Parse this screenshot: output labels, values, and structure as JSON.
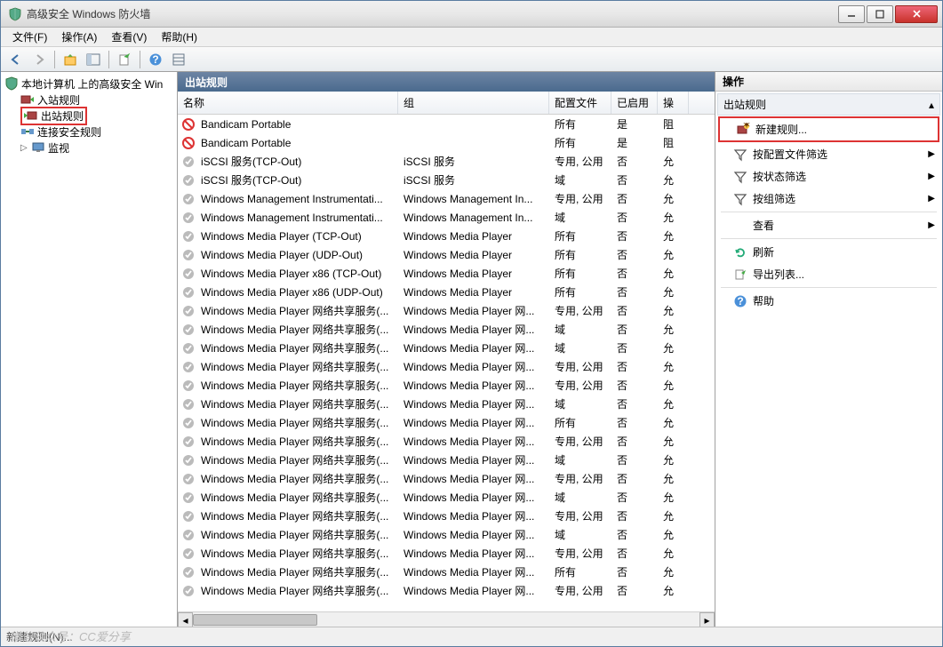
{
  "window": {
    "title": "高级安全 Windows 防火墙"
  },
  "menu": {
    "file": "文件(F)",
    "action": "操作(A)",
    "view": "查看(V)",
    "help": "帮助(H)"
  },
  "tree": {
    "root": "本地计算机 上的高级安全 Win",
    "inbound": "入站规则",
    "outbound": "出站规则",
    "connsec": "连接安全规则",
    "monitor": "监视"
  },
  "center": {
    "title": "出站规则",
    "columns": {
      "name": "名称",
      "group": "组",
      "profile": "配置文件",
      "enabled": "已启用",
      "action": "操"
    },
    "rows": [
      {
        "icon": "block",
        "name": "Bandicam Portable",
        "group": "",
        "profile": "所有",
        "enabled": "是",
        "action": "阻"
      },
      {
        "icon": "block",
        "name": "Bandicam Portable",
        "group": "",
        "profile": "所有",
        "enabled": "是",
        "action": "阻"
      },
      {
        "icon": "off",
        "name": "iSCSI 服务(TCP-Out)",
        "group": "iSCSI 服务",
        "profile": "专用, 公用",
        "enabled": "否",
        "action": "允"
      },
      {
        "icon": "off",
        "name": "iSCSI 服务(TCP-Out)",
        "group": "iSCSI 服务",
        "profile": "域",
        "enabled": "否",
        "action": "允"
      },
      {
        "icon": "off",
        "name": "Windows Management Instrumentati...",
        "group": "Windows Management In...",
        "profile": "专用, 公用",
        "enabled": "否",
        "action": "允"
      },
      {
        "icon": "off",
        "name": "Windows Management Instrumentati...",
        "group": "Windows Management In...",
        "profile": "域",
        "enabled": "否",
        "action": "允"
      },
      {
        "icon": "off",
        "name": "Windows Media Player (TCP-Out)",
        "group": "Windows Media Player",
        "profile": "所有",
        "enabled": "否",
        "action": "允"
      },
      {
        "icon": "off",
        "name": "Windows Media Player (UDP-Out)",
        "group": "Windows Media Player",
        "profile": "所有",
        "enabled": "否",
        "action": "允"
      },
      {
        "icon": "off",
        "name": "Windows Media Player x86 (TCP-Out)",
        "group": "Windows Media Player",
        "profile": "所有",
        "enabled": "否",
        "action": "允"
      },
      {
        "icon": "off",
        "name": "Windows Media Player x86 (UDP-Out)",
        "group": "Windows Media Player",
        "profile": "所有",
        "enabled": "否",
        "action": "允"
      },
      {
        "icon": "off",
        "name": "Windows Media Player 网络共享服务(...",
        "group": "Windows Media Player 网...",
        "profile": "专用, 公用",
        "enabled": "否",
        "action": "允"
      },
      {
        "icon": "off",
        "name": "Windows Media Player 网络共享服务(...",
        "group": "Windows Media Player 网...",
        "profile": "域",
        "enabled": "否",
        "action": "允"
      },
      {
        "icon": "off",
        "name": "Windows Media Player 网络共享服务(...",
        "group": "Windows Media Player 网...",
        "profile": "域",
        "enabled": "否",
        "action": "允"
      },
      {
        "icon": "off",
        "name": "Windows Media Player 网络共享服务(...",
        "group": "Windows Media Player 网...",
        "profile": "专用, 公用",
        "enabled": "否",
        "action": "允"
      },
      {
        "icon": "off",
        "name": "Windows Media Player 网络共享服务(...",
        "group": "Windows Media Player 网...",
        "profile": "专用, 公用",
        "enabled": "否",
        "action": "允"
      },
      {
        "icon": "off",
        "name": "Windows Media Player 网络共享服务(...",
        "group": "Windows Media Player 网...",
        "profile": "域",
        "enabled": "否",
        "action": "允"
      },
      {
        "icon": "off",
        "name": "Windows Media Player 网络共享服务(...",
        "group": "Windows Media Player 网...",
        "profile": "所有",
        "enabled": "否",
        "action": "允"
      },
      {
        "icon": "off",
        "name": "Windows Media Player 网络共享服务(...",
        "group": "Windows Media Player 网...",
        "profile": "专用, 公用",
        "enabled": "否",
        "action": "允"
      },
      {
        "icon": "off",
        "name": "Windows Media Player 网络共享服务(...",
        "group": "Windows Media Player 网...",
        "profile": "域",
        "enabled": "否",
        "action": "允"
      },
      {
        "icon": "off",
        "name": "Windows Media Player 网络共享服务(...",
        "group": "Windows Media Player 网...",
        "profile": "专用, 公用",
        "enabled": "否",
        "action": "允"
      },
      {
        "icon": "off",
        "name": "Windows Media Player 网络共享服务(...",
        "group": "Windows Media Player 网...",
        "profile": "域",
        "enabled": "否",
        "action": "允"
      },
      {
        "icon": "off",
        "name": "Windows Media Player 网络共享服务(...",
        "group": "Windows Media Player 网...",
        "profile": "专用, 公用",
        "enabled": "否",
        "action": "允"
      },
      {
        "icon": "off",
        "name": "Windows Media Player 网络共享服务(...",
        "group": "Windows Media Player 网...",
        "profile": "域",
        "enabled": "否",
        "action": "允"
      },
      {
        "icon": "off",
        "name": "Windows Media Player 网络共享服务(...",
        "group": "Windows Media Player 网...",
        "profile": "专用, 公用",
        "enabled": "否",
        "action": "允"
      },
      {
        "icon": "off",
        "name": "Windows Media Player 网络共享服务(...",
        "group": "Windows Media Player 网...",
        "profile": "所有",
        "enabled": "否",
        "action": "允"
      },
      {
        "icon": "off",
        "name": "Windows Media Player 网络共享服务(...",
        "group": "Windows Media Player 网...",
        "profile": "专用, 公用",
        "enabled": "否",
        "action": "允"
      }
    ]
  },
  "actions": {
    "header": "操作",
    "group": "出站规则",
    "new_rule": "新建规则...",
    "filter_profile": "按配置文件筛选",
    "filter_state": "按状态筛选",
    "filter_group": "按组筛选",
    "view": "查看",
    "refresh": "刷新",
    "export": "导出列表...",
    "help": "帮助"
  },
  "status": {
    "text": "新建规则(N)...",
    "watermark": "微信公众号：CC爱分享"
  }
}
